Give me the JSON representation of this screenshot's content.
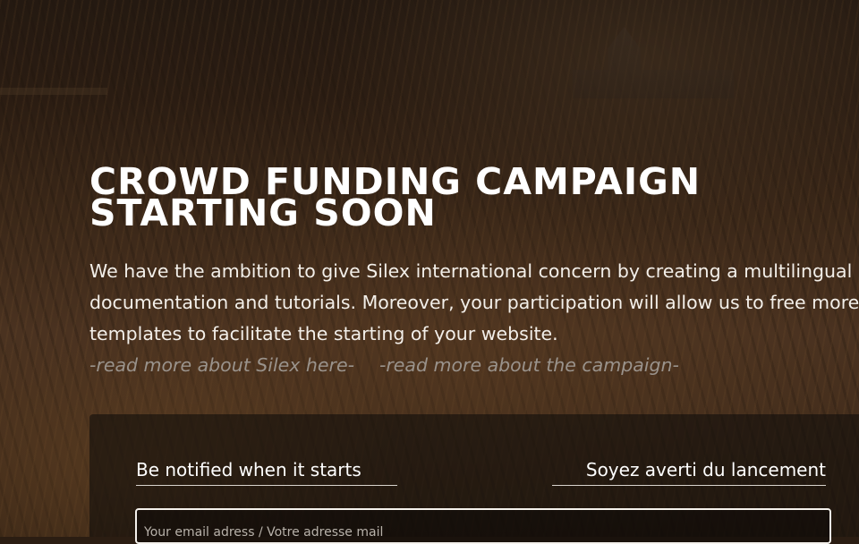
{
  "hero": {
    "title": "CROWD FUNDING CAMPAIGN STARTING SOON",
    "description": "We have the ambition to give Silex international concern by creating a multilingual documentation and tutorials. Moreover, your participation will allow us to free more templates to facilitate the starting of your website."
  },
  "links": {
    "silex": "-read more about Silex here-",
    "campaign": "-read more about the campaign-"
  },
  "signup": {
    "notify_en": "Be notified when it starts",
    "notify_fr": "Soyez averti du lancement",
    "email_placeholder": "Your email adress / Votre adresse mail"
  },
  "colors": {
    "title": "#ffffff",
    "link": "#9a938c",
    "panel": "#120e0b"
  }
}
